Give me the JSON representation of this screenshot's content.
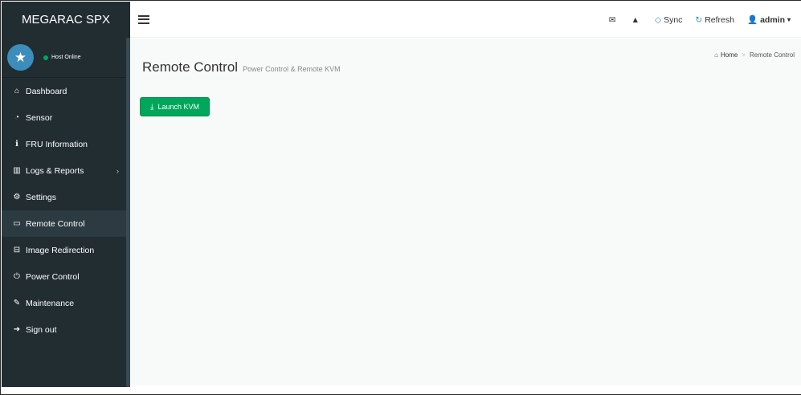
{
  "app": {
    "brand": "MEGARAC SPX"
  },
  "user_panel": {
    "status": "Host Online"
  },
  "sidebar": {
    "items": [
      {
        "label": "Dashboard",
        "icon": "home-icon",
        "glyph": "⌂"
      },
      {
        "label": "Sensor",
        "icon": "tachometer-icon",
        "glyph": "◔"
      },
      {
        "label": "FRU Information",
        "icon": "info-icon",
        "glyph": "ℹ"
      },
      {
        "label": "Logs & Reports",
        "icon": "chart-icon",
        "glyph": "▥"
      },
      {
        "label": "Settings",
        "icon": "gear-icon",
        "glyph": "⚙"
      },
      {
        "label": "Remote Control",
        "icon": "monitor-icon",
        "glyph": "▭"
      },
      {
        "label": "Image Redirection",
        "icon": "drive-icon",
        "glyph": "⊟"
      },
      {
        "label": "Power Control",
        "icon": "power-icon",
        "glyph": "⏻"
      },
      {
        "label": "Maintenance",
        "icon": "wrench-icon",
        "glyph": "✎"
      },
      {
        "label": "Sign out",
        "icon": "sign-out-icon",
        "glyph": "➜"
      }
    ]
  },
  "header": {
    "sync_label": "Sync",
    "refresh_label": "Refresh",
    "user_label": "admin"
  },
  "main": {
    "title": "Remote Control",
    "subtitle": "Power Control & Remote KVM",
    "breadcrumb_home": "Home",
    "breadcrumb_current": "Remote Control",
    "launch_button": "Launch KVM"
  },
  "colors": {
    "sidebar_bg": "#222d32",
    "accent": "#3c8dbc",
    "success": "#00a65a"
  }
}
